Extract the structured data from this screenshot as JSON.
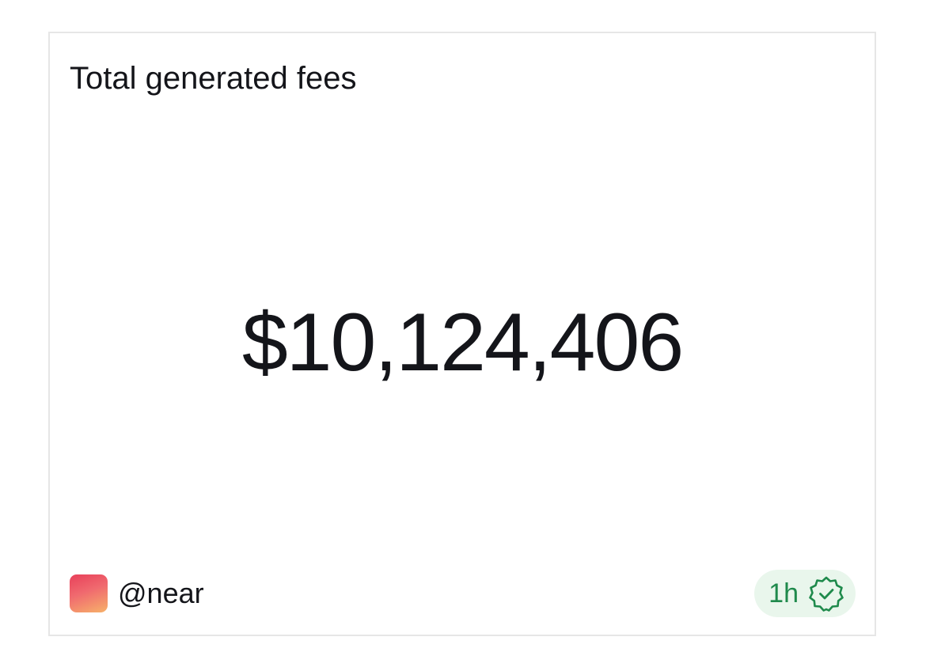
{
  "card": {
    "title": "Total generated fees",
    "value": "$10,124,406",
    "author": {
      "handle": "@near",
      "avatar_icon": "gradient-avatar"
    },
    "badge": {
      "label": "1h",
      "icon": "verified-check-icon",
      "color": "#1f8a4c",
      "background": "#e9f6ec"
    }
  }
}
